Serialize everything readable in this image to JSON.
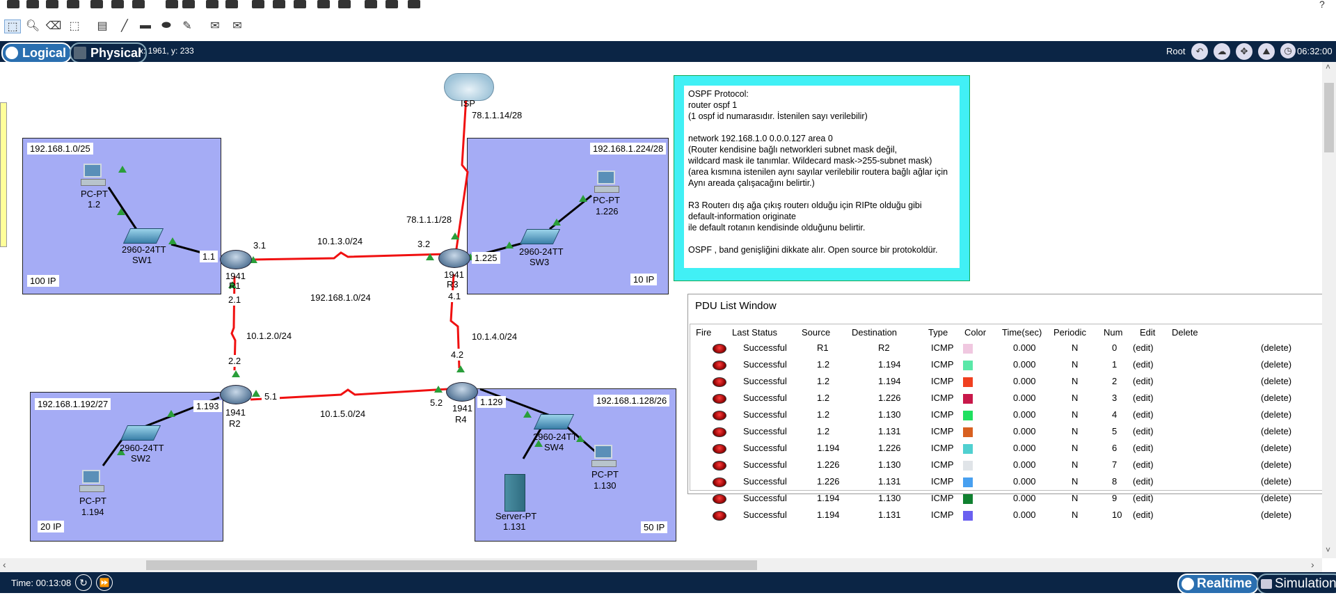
{
  "nav": {
    "logical_label": "Logical",
    "physical_label": "Physical",
    "coords": "x: 1961, y: 233",
    "root_label": "Root",
    "clock": "06:32:00"
  },
  "topology": {
    "areas": [
      {
        "network": "192.168.1.0/25",
        "ip_count": "100 IP"
      },
      {
        "network": "192.168.1.224/28",
        "ip_count": "10 IP"
      },
      {
        "network": "192.168.1.192/27",
        "ip_count": "20 IP"
      },
      {
        "network": "192.168.1.128/26",
        "ip_count": "50 IP"
      }
    ],
    "link_labels": {
      "r1_r3": "10.1.3.0/24",
      "r1_r2": "10.1.2.0/24",
      "r2_r4": "10.1.5.0/24",
      "r3_r4": "10.1.4.0/24",
      "isp_r3_top": "78.1.1.14/28",
      "isp_r3_bottom": "78.1.1.1/28",
      "center": "192.168.1.0/24"
    },
    "interfaces": {
      "r1_31": "3.1",
      "r1_11": "1.1",
      "r1_21": "2.1",
      "r3_32": "3.2",
      "r3_1225": "1.225",
      "r3_41": "4.1",
      "r2_22": "2.2",
      "r2_1193": "1.193",
      "r2_51": "5.1",
      "r4_42": "4.2",
      "r4_52": "5.2",
      "r4_1129": "1.129"
    },
    "devices": {
      "isp": "ISP",
      "r1": {
        "model": "1941",
        "name": "R1"
      },
      "r2": {
        "model": "1941",
        "name": "R2"
      },
      "r3": {
        "model": "1941",
        "name": "R3"
      },
      "r4": {
        "model": "1941",
        "name": "R4"
      },
      "sw1": {
        "model": "2960-24TT",
        "name": "SW1"
      },
      "sw2": {
        "model": "2960-24TT",
        "name": "SW2"
      },
      "sw3": {
        "model": "2960-24TT",
        "name": "SW3"
      },
      "sw4": {
        "model": "2960-24TT",
        "name": "SW4"
      },
      "pc1": {
        "type": "PC-PT",
        "ip": "1.2"
      },
      "pc2": {
        "type": "PC-PT",
        "ip": "1.226"
      },
      "pc3": {
        "type": "PC-PT",
        "ip": "1.194"
      },
      "pc4": {
        "type": "PC-PT",
        "ip": "1.130"
      },
      "server": {
        "type": "Server-PT",
        "ip": "1.131"
      }
    }
  },
  "note": {
    "lines": [
      "OSPF Protocol:",
      "router ospf 1",
      "(1 ospf id numarasıdır. İstenilen sayı verilebilir)",
      "",
      "network 192.168.1.0 0.0.0.127 area 0",
      "(Router kendisine bağlı networkleri subnet mask değil,",
      "wildcard mask ile tanımlar. Wildecard mask->255-subnet mask)",
      "(area kısmına istenilen aynı sayılar verilebilir routera bağlı ağlar için",
      "Aynı areada çalışacağını belirtir.)",
      "",
      "R3 Routerı dış ağa çıkış routerı olduğu için RIPte olduğu gibi",
      "default-information originate",
      "ile default rotanın kendisinde olduğunu belirtir.",
      "",
      "OSPF , band genişliğini dikkate alır. Open source bir protokoldür."
    ]
  },
  "pdu": {
    "title": "PDU List Window",
    "headers": [
      "Fire",
      "Last Status",
      "Source",
      "Destination",
      "Type",
      "Color",
      "Time(sec)",
      "Periodic",
      "Num",
      "Edit",
      "Delete"
    ],
    "rows": [
      {
        "status": "Successful",
        "source": "R1",
        "dest": "R2",
        "type": "ICMP",
        "color": "#f0c8e0",
        "time": "0.000",
        "periodic": "N",
        "num": "0",
        "edit": "(edit)",
        "delete": "(delete)"
      },
      {
        "status": "Successful",
        "source": "1.2",
        "dest": "1.194",
        "type": "ICMP",
        "color": "#5ae8a8",
        "time": "0.000",
        "periodic": "N",
        "num": "1",
        "edit": "(edit)",
        "delete": "(delete)"
      },
      {
        "status": "Successful",
        "source": "1.2",
        "dest": "1.194",
        "type": "ICMP",
        "color": "#f04020",
        "time": "0.000",
        "periodic": "N",
        "num": "2",
        "edit": "(edit)",
        "delete": "(delete)"
      },
      {
        "status": "Successful",
        "source": "1.2",
        "dest": "1.226",
        "type": "ICMP",
        "color": "#c8184a",
        "time": "0.000",
        "periodic": "N",
        "num": "3",
        "edit": "(edit)",
        "delete": "(delete)"
      },
      {
        "status": "Successful",
        "source": "1.2",
        "dest": "1.130",
        "type": "ICMP",
        "color": "#20e060",
        "time": "0.000",
        "periodic": "N",
        "num": "4",
        "edit": "(edit)",
        "delete": "(delete)"
      },
      {
        "status": "Successful",
        "source": "1.2",
        "dest": "1.131",
        "type": "ICMP",
        "color": "#d86020",
        "time": "0.000",
        "periodic": "N",
        "num": "5",
        "edit": "(edit)",
        "delete": "(delete)"
      },
      {
        "status": "Successful",
        "source": "1.194",
        "dest": "1.226",
        "type": "ICMP",
        "color": "#50d0d0",
        "time": "0.000",
        "periodic": "N",
        "num": "6",
        "edit": "(edit)",
        "delete": "(delete)"
      },
      {
        "status": "Successful",
        "source": "1.226",
        "dest": "1.130",
        "type": "ICMP",
        "color": "#e0e4e8",
        "time": "0.000",
        "periodic": "N",
        "num": "7",
        "edit": "(edit)",
        "delete": "(delete)"
      },
      {
        "status": "Successful",
        "source": "1.226",
        "dest": "1.131",
        "type": "ICMP",
        "color": "#48a0f0",
        "time": "0.000",
        "periodic": "N",
        "num": "8",
        "edit": "(edit)",
        "delete": "(delete)"
      },
      {
        "status": "Successful",
        "source": "1.194",
        "dest": "1.130",
        "type": "ICMP",
        "color": "#108030",
        "time": "0.000",
        "periodic": "N",
        "num": "9",
        "edit": "(edit)",
        "delete": "(delete)"
      },
      {
        "status": "Successful",
        "source": "1.194",
        "dest": "1.131",
        "type": "ICMP",
        "color": "#6a60f0",
        "time": "0.000",
        "periodic": "N",
        "num": "10",
        "edit": "(edit)",
        "delete": "(delete)"
      }
    ]
  },
  "bottom": {
    "time_label": "Time: 00:13:08",
    "realtime_label": "Realtime",
    "simulation_label": "Simulation"
  },
  "colors": {
    "nav_bg": "#0b2545",
    "area_fill": "#a5acf5",
    "note_bg": "#41f0f5",
    "link_red": "#f01010",
    "link_black": "#000000",
    "port_green": "#2a9e3a"
  }
}
